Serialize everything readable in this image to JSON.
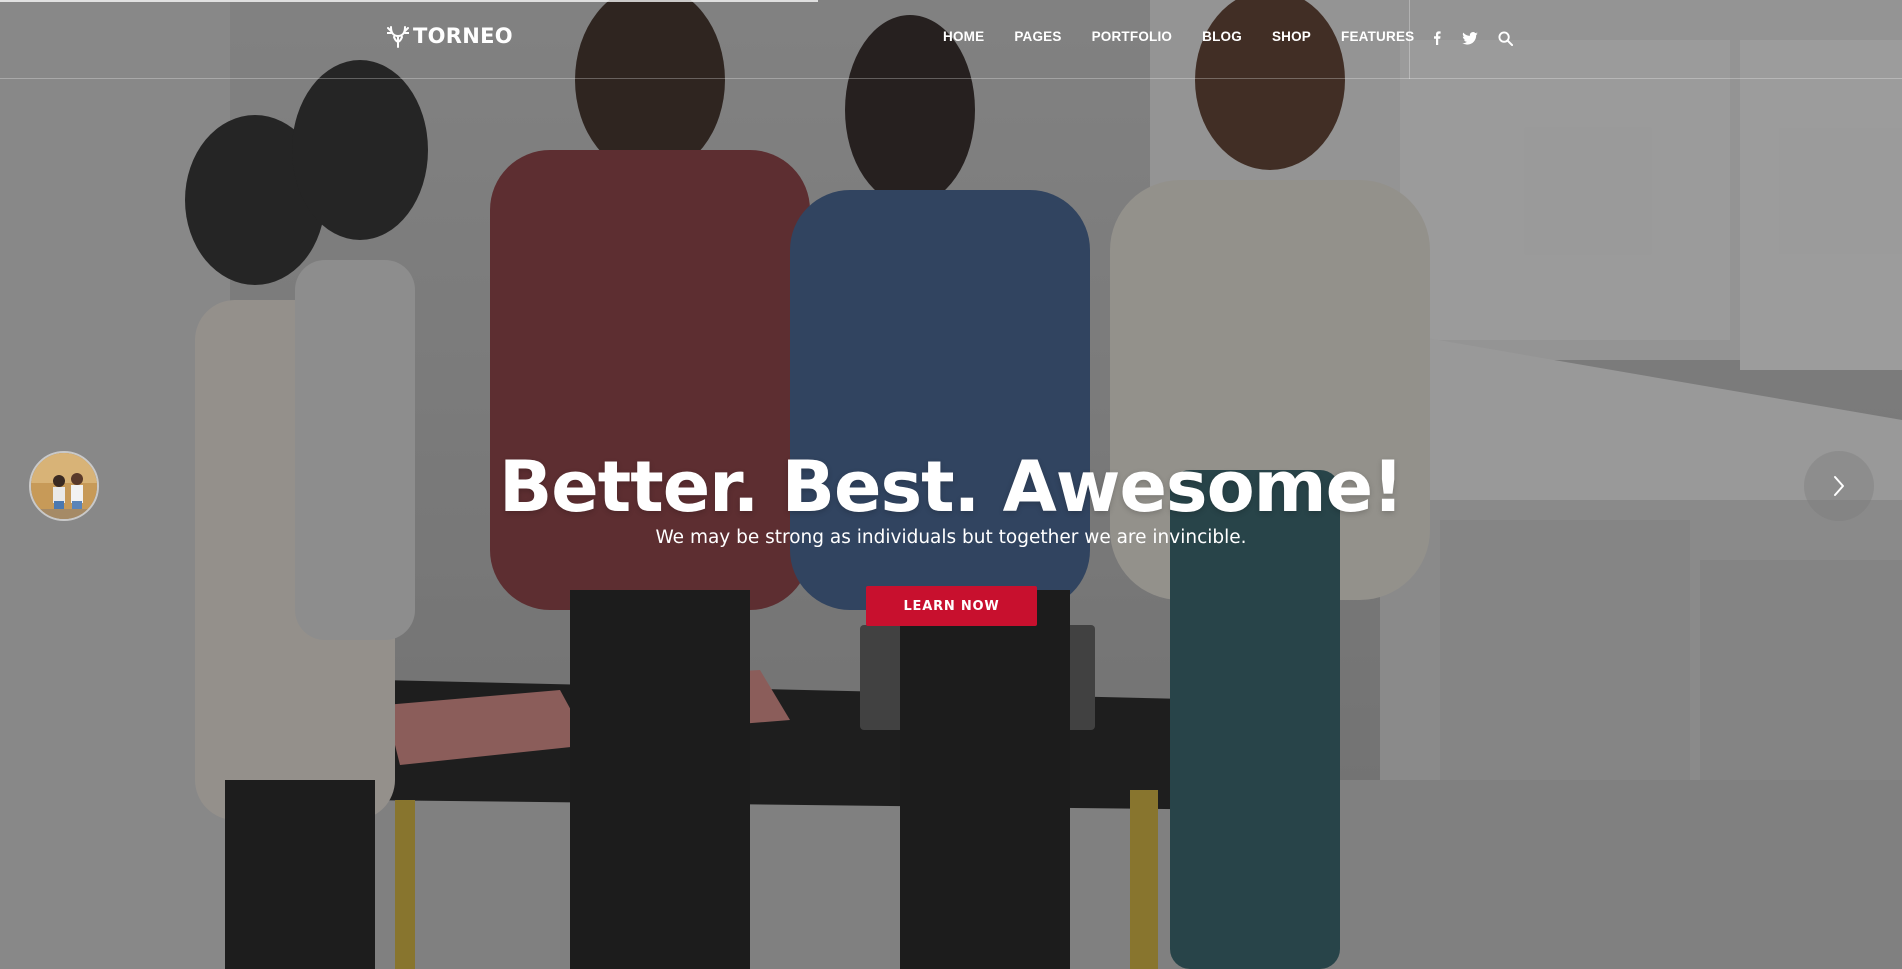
{
  "brand": {
    "name": "TORNEO"
  },
  "nav": {
    "items": [
      {
        "label": "HOME"
      },
      {
        "label": "PAGES"
      },
      {
        "label": "PORTFOLIO"
      },
      {
        "label": "BLOG"
      },
      {
        "label": "SHOP"
      },
      {
        "label": "FEATURES"
      }
    ]
  },
  "header_icons": [
    "facebook-icon",
    "twitter-icon",
    "search-icon"
  ],
  "slider": {
    "progress_fraction": 0.43,
    "prev_control": "previous-slide-thumbnail",
    "next_control": "chevron-right-icon"
  },
  "hero": {
    "title": "Better. Best. Awesome!",
    "subtitle": "We may be strong as individuals but together we are invincible.",
    "cta_label": "LEARN NOW"
  },
  "colors": {
    "accent": "#c8102e",
    "text": "#ffffff",
    "overlay": "rgba(30,30,30,0.42)"
  }
}
